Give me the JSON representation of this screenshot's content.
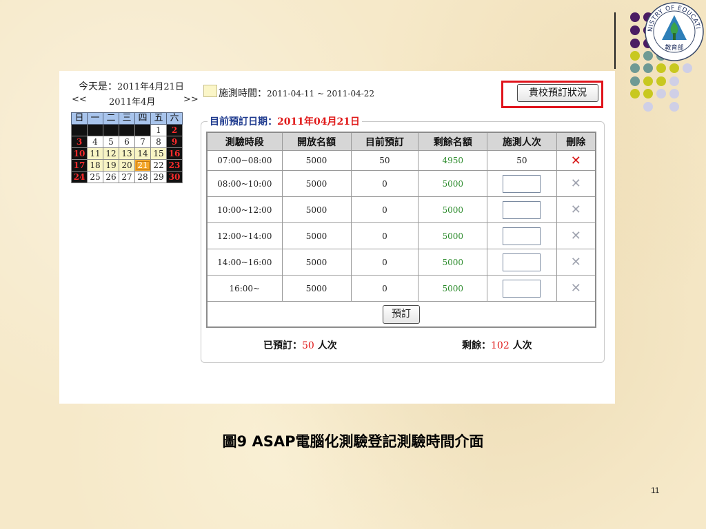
{
  "today": {
    "label": "今天是：",
    "value": "2011年4月21日"
  },
  "calendar": {
    "prev": "<<",
    "next": ">>",
    "month": "2011年4月",
    "weekdays": [
      "日",
      "一",
      "二",
      "三",
      "四",
      "五",
      "六"
    ],
    "weeks": [
      [
        "",
        "",
        "",
        "",
        "",
        "1",
        "2"
      ],
      [
        "3",
        "4",
        "5",
        "6",
        "7",
        "8",
        "9"
      ],
      [
        "10",
        "11",
        "12",
        "13",
        "14",
        "15",
        "16"
      ],
      [
        "17",
        "18",
        "19",
        "20",
        "21",
        "22",
        "23"
      ],
      [
        "24",
        "25",
        "26",
        "27",
        "28",
        "29",
        "30"
      ]
    ]
  },
  "legend": {
    "label": "施測時間：",
    "range": "2011-04-11 ~ 2011-04-22"
  },
  "status_button": "貴校預訂狀況",
  "panel": {
    "title": "目前預訂日期：",
    "date": "2011年04月21日"
  },
  "table": {
    "headers": [
      "測驗時段",
      "開放名額",
      "目前預訂",
      "剩餘名額",
      "施測人次",
      "刪除"
    ],
    "rows": [
      {
        "slot": "07:00~08:00",
        "open": "5000",
        "booked": "50",
        "remaining": "4950",
        "count": "50",
        "delete": "✕"
      },
      {
        "slot": "08:00~10:00",
        "open": "5000",
        "booked": "0",
        "remaining": "5000",
        "count": "",
        "delete": "✕"
      },
      {
        "slot": "10:00~12:00",
        "open": "5000",
        "booked": "0",
        "remaining": "5000",
        "count": "",
        "delete": "✕"
      },
      {
        "slot": "12:00~14:00",
        "open": "5000",
        "booked": "0",
        "remaining": "5000",
        "count": "",
        "delete": "✕"
      },
      {
        "slot": "14:00~16:00",
        "open": "5000",
        "booked": "0",
        "remaining": "5000",
        "count": "",
        "delete": "✕"
      },
      {
        "slot": "16:00~",
        "open": "5000",
        "booked": "0",
        "remaining": "5000",
        "count": "",
        "delete": "✕"
      }
    ],
    "book_button": "預訂"
  },
  "summary": {
    "booked_label": "已預訂：",
    "booked_value": "50",
    "booked_unit": "人次",
    "remaining_label": "剩餘：",
    "remaining_value": "102",
    "remaining_unit": "人次"
  },
  "logo": {
    "text": "MINISTRY OF EDUCATION",
    "chinese": "教育部"
  },
  "caption": "圖9  ASAP電腦化測驗登記測驗時間介面",
  "page_number": "11",
  "colors": {
    "accent_red": "#e01a1a",
    "title_blue": "#1f3b8f",
    "remaining_green": "#2a8a2a",
    "highlight_box": "#e0141c",
    "purple": "#4b1c63",
    "teal": "#6f9a94",
    "lime": "#c8c820",
    "lavender": "#cfcfe6"
  }
}
